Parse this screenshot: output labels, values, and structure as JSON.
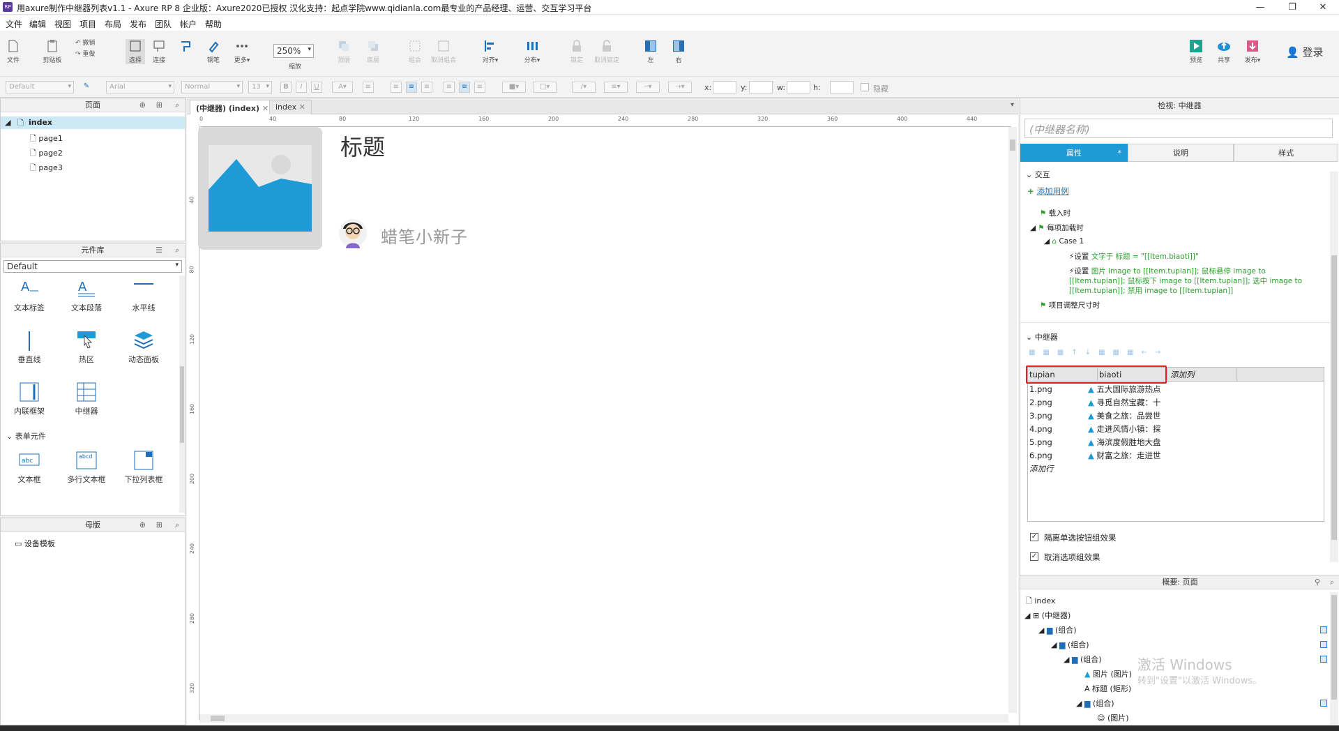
{
  "title": "用axure制作中继器列表v1.1 - Axure RP 8 企业版：Axure2020已授权 汉化支持：起点学院www.qidianla.com最专业的产品经理、运营、交互学习平台",
  "app_icon": "RP",
  "window_controls": {
    "minimize": "—",
    "restore": "❐",
    "close": "✕"
  },
  "menu": [
    "文件",
    "编辑",
    "视图",
    "项目",
    "布局",
    "发布",
    "团队",
    "帐户",
    "帮助"
  ],
  "toolbar": {
    "file": "文件",
    "clipboard": "剪贴板",
    "undo": "撤销",
    "redo": "重做",
    "select": "选择",
    "connect": "连接",
    "pen": "钢笔",
    "more": "更多▾",
    "zoom": "250%",
    "zoom_label": "缩放",
    "top": "顶层",
    "bottom": "底层",
    "group": "组合",
    "ungroup": "取消组合",
    "align": "对齐▾",
    "distribute": "分布▾",
    "lock": "锁定",
    "unlock": "取消锁定",
    "left": "左",
    "right": "右",
    "preview": "预览",
    "share": "共享",
    "publish": "发布▾",
    "login": "登录"
  },
  "format": {
    "style": "Default",
    "font": "Arial",
    "weight": "Normal",
    "size": "13",
    "x_label": "x:",
    "y_label": "y:",
    "w_label": "w:",
    "h_label": "h:",
    "hidden": "隐藏"
  },
  "pages_panel": {
    "title": "页面",
    "root": "index",
    "pages": [
      "page1",
      "page2",
      "page3"
    ]
  },
  "library_panel": {
    "title": "元件库",
    "library": "Default",
    "widgets": [
      "文本标签",
      "文本段落",
      "水平线",
      "垂直线",
      "热区",
      "动态面板",
      "内联框架",
      "中继器"
    ],
    "form_section": "表单元件",
    "form_widgets": [
      "文本框",
      "多行文本框",
      "下拉列表框"
    ]
  },
  "masters_panel": {
    "title": "母版",
    "items": [
      "设备模板"
    ]
  },
  "tabs": [
    {
      "label": "(中继器) (index)",
      "close": "✕"
    },
    {
      "label": "index",
      "close": "✕"
    }
  ],
  "ruler_h": [
    "0",
    "40",
    "80",
    "120",
    "160",
    "200",
    "240",
    "280",
    "320",
    "360",
    "400",
    "440"
  ],
  "ruler_v": [
    "40",
    "80",
    "120",
    "160",
    "200",
    "240",
    "280",
    "320"
  ],
  "canvas": {
    "heading": "标题",
    "author": "蜡笔小新子"
  },
  "inspector": {
    "title": "检视: 中继器",
    "name_placeholder": "(中继器名称)",
    "tabs": [
      "属性",
      "说明",
      "样式"
    ],
    "tab_marker": "*",
    "interaction_section": "交互",
    "add_case": "添加用例",
    "events": {
      "onload": "载入时",
      "item_load": "每项加载时",
      "case": "Case 1",
      "action1_prefix": "设置",
      "action1_detail": "文字于 标题 = \"[[Item.biaoti]]\"",
      "action2_prefix": "设置",
      "action2_detail": "图片 image to [[Item.tupian]]; 鼠标悬停 image to [[Item.tupian]]; 鼠标按下 image to [[Item.tupian]]; 选中 image to [[Item.tupian]]; 禁用 image to [[Item.tupian]]",
      "resize": "项目调整尺寸时"
    },
    "repeater_section": "中继器",
    "columns": [
      "tupian",
      "biaoti",
      "添加列"
    ],
    "rows": [
      [
        "1.png",
        "五大国际旅游热点"
      ],
      [
        "2.png",
        "寻觅自然宝藏：十"
      ],
      [
        "3.png",
        "美食之旅：品尝世"
      ],
      [
        "4.png",
        "走进风情小镇：探"
      ],
      [
        "5.png",
        "海滨度假胜地大盘"
      ],
      [
        "6.png",
        "财富之旅：走进世"
      ]
    ],
    "add_row": "添加行",
    "opt1": "隔离单选按钮组效果",
    "opt2": "取消选项组效果"
  },
  "outline": {
    "title": "概要: 页面",
    "items": [
      "index",
      "(中继器)",
      "(组合)",
      "(组合)",
      "(组合)",
      "图片 (图片)",
      "标题 (矩形)",
      "(组合)",
      "(图片)"
    ]
  },
  "watermark": {
    "line1": "激活 Windows",
    "line2": "转到\"设置\"以激活 Windows。"
  },
  "colors": {
    "accent": "#1e9ad6",
    "highlight": "#e02020",
    "image_placeholder": "#1e9ad6"
  }
}
